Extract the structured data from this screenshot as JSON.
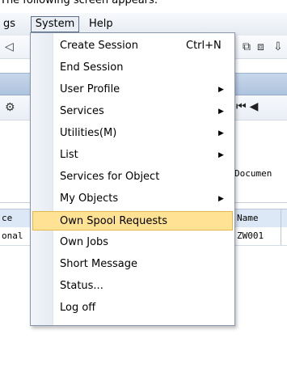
{
  "caption": "The following screen appears:",
  "menubar": {
    "left_item": "gs",
    "system": "System",
    "help": "Help"
  },
  "dropdown": {
    "items": [
      {
        "label": "Create Session",
        "shortcut": "Ctrl+N",
        "submenu": false
      },
      {
        "label": "End Session",
        "submenu": false
      },
      {
        "label": "User Profile",
        "submenu": true
      },
      {
        "label": "Services",
        "submenu": true
      },
      {
        "label": "Utilities(M)",
        "submenu": true
      },
      {
        "label": "List",
        "submenu": true
      },
      {
        "label": "Services for Object",
        "submenu": false
      },
      {
        "label": "My Objects",
        "submenu": true
      },
      {
        "label": "Own Spool Requests",
        "submenu": false,
        "selected": true
      },
      {
        "label": "Own Jobs",
        "submenu": false
      },
      {
        "label": "Short Message",
        "submenu": false
      },
      {
        "label": "Status...",
        "submenu": false
      },
      {
        "label": "Log off",
        "submenu": false
      }
    ]
  },
  "background": {
    "doc_label": "Documen",
    "table": {
      "header": {
        "col1": "ce",
        "col2": "Name"
      },
      "row": {
        "col1": "onal",
        "col2": "ZW001"
      }
    }
  }
}
